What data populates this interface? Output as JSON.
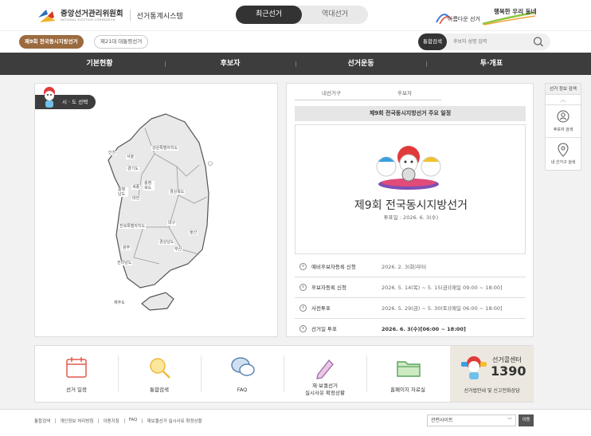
{
  "header": {
    "org": "중앙선거관리위원회",
    "org_eng": "NATIONAL ELECTION COMMISSION",
    "system": "선거통계시스템",
    "tabs": [
      "최근선거",
      "역대선거"
    ],
    "slogan_top": "행복한 우리 동네",
    "slogan_bottom": "아름다운 선거"
  },
  "subbar": {
    "election1": "제9회 전국동시지방선거",
    "election2": "제21대 대통령선거",
    "search_label": "통합검색",
    "search_placeholder": "후보자 성명 입력"
  },
  "mainnav": [
    "기본현황",
    "후보자",
    "선거운동",
    "투·개표"
  ],
  "map": {
    "badge": "시 · 도 선택",
    "regions": {
      "incheon": "인천",
      "seoul": "서울",
      "gyeonggi": "경기도",
      "gangwon": "강원특별자치도",
      "chungbuk": "충청\n북도",
      "chungnam": "충청\n남도",
      "sejong": "세종",
      "daejeon": "대전",
      "gyeongbuk": "경상북도",
      "daegu": "대구",
      "jeonbuk": "전북특별자치도",
      "ulsan": "울산",
      "gyeongnam": "경상남도",
      "busan": "부산",
      "gwangju": "광주",
      "jeonnam": "전라남도",
      "jeju": "제주도"
    }
  },
  "info": {
    "subtabs": [
      "내선거구",
      "후보자"
    ],
    "schedule_title": "제9회 전국동시지방선거 주요 일정",
    "hero_title": "제9회 전국동시지방선거",
    "hero_date": "투표일 : 2026. 6. 3(수)",
    "schedule": [
      {
        "label": "예비후보자등록 신청",
        "value": "2026. 2. 3(화)부터"
      },
      {
        "label": "후보자등록 신청",
        "value": "2026. 5. 14(목) ~ 5. 15(금)[매일 09:00 ~ 18:00]"
      },
      {
        "label": "사전투표",
        "value": "2026. 5. 29(금) ~ 5. 30(토)[매일 06:00 ~ 18:00]"
      },
      {
        "label": "선거일 투표",
        "value": "2026. 6. 3(수)[06:00 ~ 18:00]"
      }
    ]
  },
  "side": {
    "header": "선거 정보 검색",
    "items": [
      "후보자 검색",
      "내 선거구 검색"
    ]
  },
  "quick": {
    "items": [
      {
        "label": "선거 일정"
      },
      {
        "label": "통합검색"
      },
      {
        "label": "FAQ"
      },
      {
        "label1": "재·보궐선거",
        "label2": "실시사유 확정상황"
      },
      {
        "label": "홈페이지 자료실"
      }
    ],
    "call_title": "선거콜센터",
    "call_number": "1390",
    "call_desc": "선거법안내 및 신고전화상담"
  },
  "footer": {
    "links": [
      "통합검색",
      "개인정보 처리방침",
      "이용지침",
      "FAQ",
      "재보궐선거 실시사유 확정상황"
    ],
    "select": "관련사이트",
    "go": "이동"
  },
  "colors": {
    "brand_brown": "#9b6a3e",
    "nav_dark": "#3d3d3d"
  }
}
